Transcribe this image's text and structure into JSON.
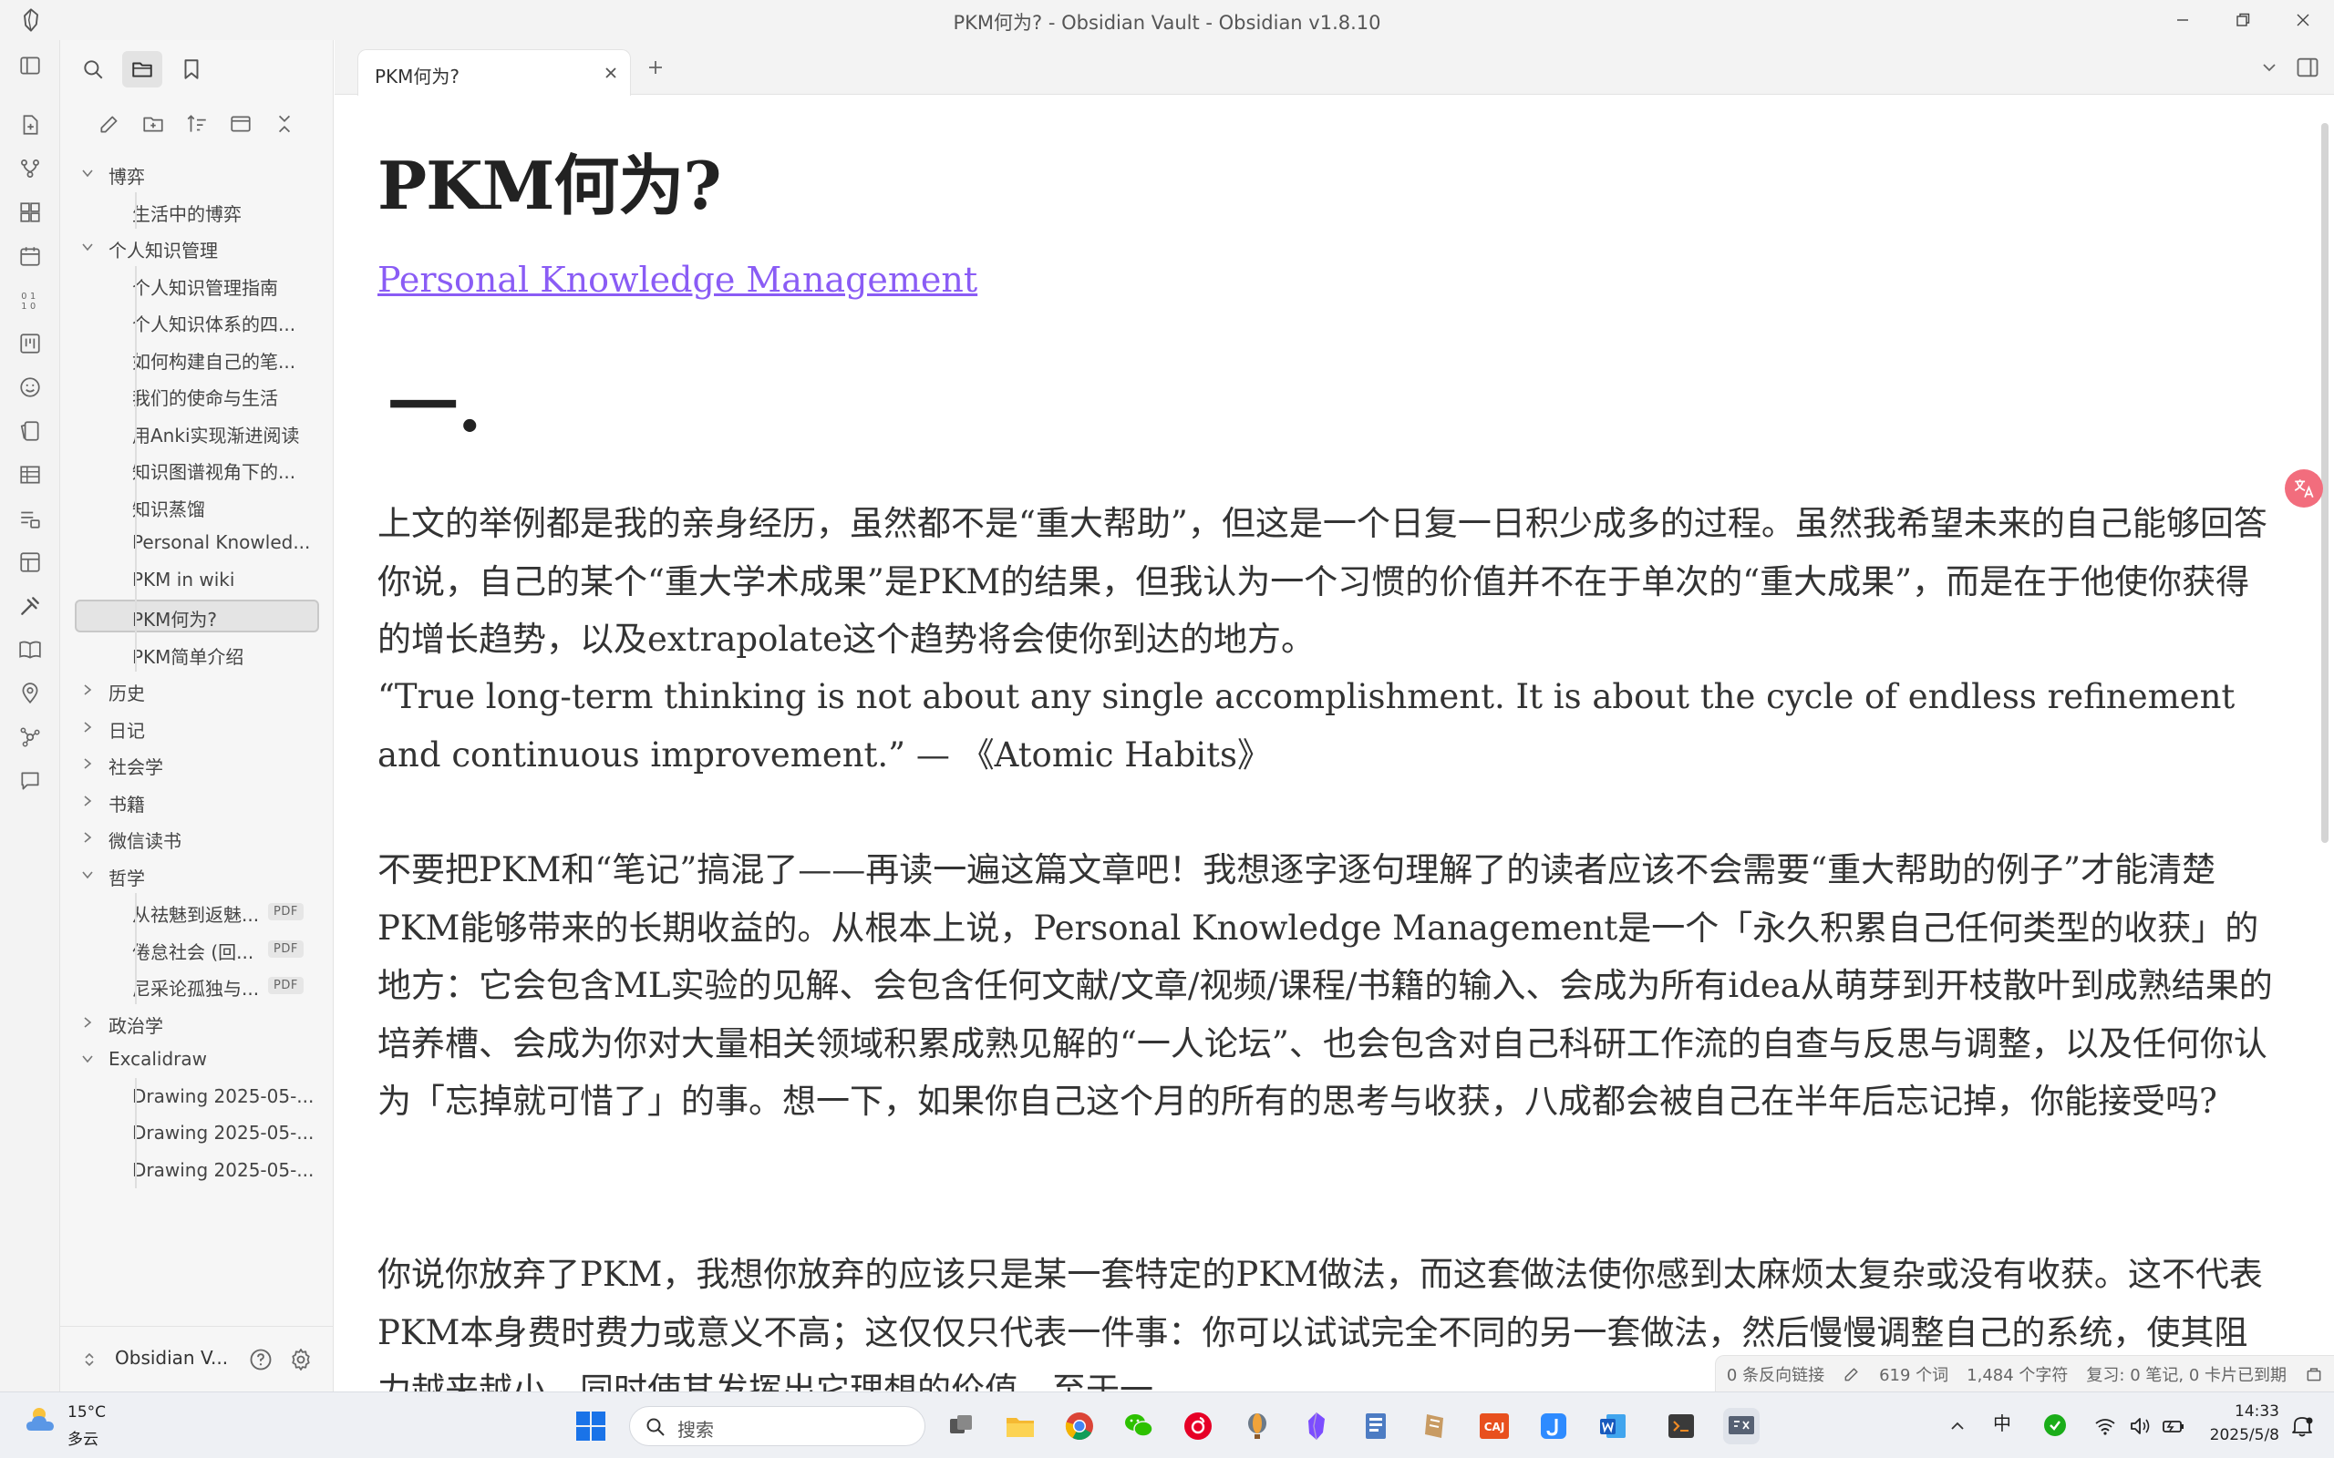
{
  "window": {
    "title": "PKM何为?  - Obsidian Vault - Obsidian v1.8.10"
  },
  "sidebar": {
    "tree": [
      {
        "type": "folder",
        "label": "博弈",
        "expanded": true
      },
      {
        "type": "file",
        "label": "生活中的博弈"
      },
      {
        "type": "folder",
        "label": "个人知识管理",
        "expanded": true
      },
      {
        "type": "file",
        "label": "个人知识管理指南"
      },
      {
        "type": "file",
        "label": "个人知识体系的四..."
      },
      {
        "type": "file",
        "label": "如何构建自己的笔..."
      },
      {
        "type": "file",
        "label": "我们的使命与生活"
      },
      {
        "type": "file",
        "label": "用Anki实现渐进阅读"
      },
      {
        "type": "file",
        "label": "知识图谱视角下的..."
      },
      {
        "type": "file",
        "label": "知识蒸馏"
      },
      {
        "type": "file",
        "label": "Personal Knowled..."
      },
      {
        "type": "file",
        "label": "PKM in wiki"
      },
      {
        "type": "file",
        "label": "PKM何为?",
        "active": true
      },
      {
        "type": "file",
        "label": "PKM简单介绍"
      },
      {
        "type": "folder",
        "label": "历史",
        "expanded": false
      },
      {
        "type": "folder",
        "label": "日记",
        "expanded": false
      },
      {
        "type": "folder",
        "label": "社会学",
        "expanded": false
      },
      {
        "type": "folder",
        "label": "书籍",
        "expanded": false
      },
      {
        "type": "folder",
        "label": "微信读书",
        "expanded": false
      },
      {
        "type": "folder",
        "label": "哲学",
        "expanded": true
      },
      {
        "type": "file",
        "label": "从祛魅到返魅...",
        "badge": "PDF"
      },
      {
        "type": "file",
        "label": "倦怠社会 (回...",
        "badge": "PDF"
      },
      {
        "type": "file",
        "label": "尼采论孤独与...",
        "badge": "PDF"
      },
      {
        "type": "folder",
        "label": "政治学",
        "expanded": false
      },
      {
        "type": "folder",
        "label": "Excalidraw",
        "expanded": true
      },
      {
        "type": "file",
        "label": "Drawing 2025-05-..."
      },
      {
        "type": "file",
        "label": "Drawing 2025-05-..."
      },
      {
        "type": "file",
        "label": "Drawing 2025-05-..."
      }
    ],
    "vault_name": "Obsidian V..."
  },
  "tabs": [
    {
      "label": "PKM何为?"
    }
  ],
  "note": {
    "title": "PKM何为?",
    "link": "Personal Knowledge Management",
    "heading": "一.",
    "paragraph1": "上文的举例都是我的亲身经历，虽然都不是“重大帮助”，但这是一个日复一日积少成多的过程。虽然我希望未来的自己能够回答你说，自己的某个“重大学术成果”是PKM的结果，但我认为一个习惯的价值并不在于单次的“重大成果”，而是在于他使你获得的增长趋势，以及extrapolate这个趋势将会使你到达的地方。",
    "quote": "“True long-term thinking is not about any single accomplishment. It is about the cycle of endless refinement and continuous improvement.” — 《Atomic Habits》",
    "paragraph2": "不要把PKM和“笔记”搞混了——再读一遍这篇文章吧！我想逐字逐句理解了的读者应该不会需要“重大帮助的例子”才能清楚PKM能够带来的长期收益的。从根本上说，Personal Knowledge Management是一个「永久积累自己任何类型的收获」的地方：它会包含ML实验的见解、会包含任何文献/文章/视频/课程/书籍的输入、会成为所有idea从萌芽到开枝散叶到成熟结果的培养槽、会成为你对大量相关领域积累成熟见解的“一人论坛”、也会包含对自己科研工作流的自查与反思与调整，以及任何你认为「忘掉就可惜了」的事。想一下，如果你自己这个月的所有的思考与收获，八成都会被自己在半年后忘记掉，你能接受吗?",
    "paragraph3": "你说你放弃了PKM，我想你放弃的应该只是某一套特定的PKM做法，而这套做法使你感到太麻烦太复杂或没有收获。这不代表PKM本身费时费力或意义不高；这仅仅只代表一件事：你可以试试完全不同的另一套做法，然后慢慢调整自己的系统，使其阻力越来越小，同时使其发挥出它理想的价值。至于一..."
  },
  "status": {
    "backlinks": "0 条反向链接",
    "words": "619 个词",
    "chars": "1,484 个字符",
    "review": "复习: 0 笔记, 0 卡片已到期"
  },
  "taskbar": {
    "weather_temp": "15°C",
    "weather_cond": "多云",
    "search_placeholder": "搜索",
    "ime": "中",
    "time": "14:33",
    "date": "2025/5/8",
    "caj_label": "CAJ"
  },
  "colors": {
    "accent": "#8a5cf5",
    "windows_blue": "#1a73e8"
  }
}
